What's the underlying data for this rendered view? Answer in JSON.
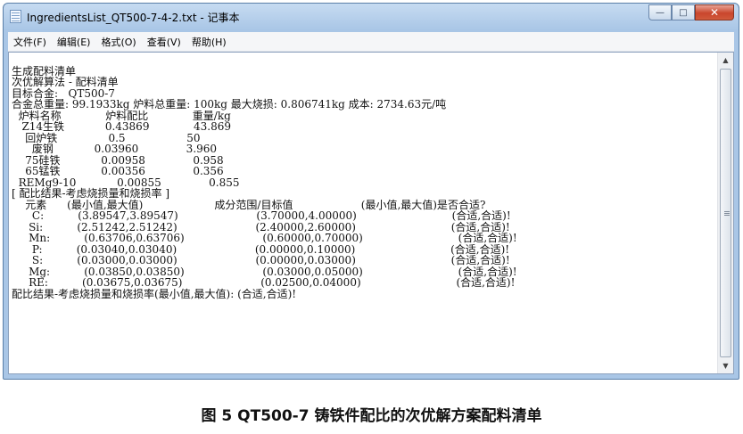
{
  "window": {
    "title": "IngredientsList_QT500-7-4-2.txt - 记事本",
    "controls": {
      "minimize": "—",
      "maximize": "□",
      "close": "✕"
    }
  },
  "menu": [
    "文件(F)",
    "编辑(E)",
    "格式(O)",
    "查看(V)",
    "帮助(H)"
  ],
  "scrollbar": {
    "up": "▲",
    "down": "▼"
  },
  "content": {
    "lines": [
      "",
      "生成配料清单",
      "次优解算法 - 配料清单",
      "目标合金:   QT500-7",
      "合金总重量: 99.1933kg 炉料总重量: 100kg 最大烧损: 0.806741kg 成本: 2734.63元/吨",
      "  炉料名称             炉料配比             重量/kg",
      "   Z14生铁            0.43869             43.869",
      "    回炉铁               0.5                  50",
      "      废钢            0.03960              3.960",
      "    75硅铁            0.00958              0.958",
      "    65锰铁            0.00356              0.356",
      "  REMg9-10            0.00855              0.855",
      "[ 配比结果-考虑烧损量和烧损率 ]",
      "    元素      (最小值,最大值)                     成分范围/目标值                    (最小值,最大值)是否合适?",
      "      C:          (3.89547,3.89547)                       (3.70000,4.00000)                            (合适,合适)!",
      "     Si:          (2.51242,2.51242)                       (2.40000,2.60000)                            (合适,合适)!",
      "     Mn:          (0.63706,0.63706)                       (0.60000,0.70000)                            (合适,合适)!",
      "      P:          (0.03040,0.03040)                       (0.00000,0.10000)                            (合适,合适)!",
      "      S:          (0.03000,0.03000)                       (0.00000,0.03000)                            (合适,合适)!",
      "     Mg:          (0.03850,0.03850)                       (0.03000,0.05000)                            (合适,合适)!",
      "     RE:          (0.03675,0.03675)                       (0.02500,0.04000)                            (合适,合适)!",
      "配比结果-考虑烧损量和烧损率(最小值,最大值): (合适,合适)!"
    ]
  },
  "caption": "图 5 QT500-7 铸铁件配比的次优解方案配料清单"
}
